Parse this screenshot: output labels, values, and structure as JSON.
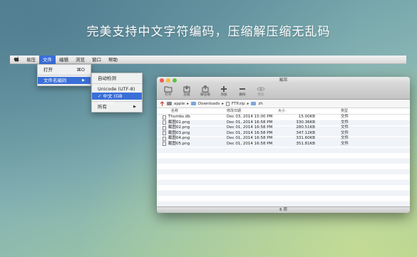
{
  "headline": "完美支持中文字符编码，压缩解压缩无乱码",
  "menubar": {
    "items": [
      "易压",
      "文件",
      "编辑",
      "浏览",
      "窗口",
      "帮助"
    ],
    "active_index": 1
  },
  "file_menu": {
    "items": [
      {
        "label": "打开",
        "shortcut": "⌘O"
      },
      {
        "label": "文件名编码",
        "submenu": "▶"
      }
    ]
  },
  "encoding_menu": {
    "items": [
      {
        "label": "自动检测"
      },
      {
        "label": "Unicode (UTF-8)"
      },
      {
        "label": "✓ 中文 (GB 18030)"
      },
      {
        "label": "所有",
        "submenu": "▶"
      }
    ],
    "selected_index": 2
  },
  "window": {
    "title": "易压",
    "toolbar": [
      "打开",
      "压缩",
      "解压缩",
      "添加",
      "删除",
      "预览"
    ],
    "path": [
      "apple",
      "Downloads",
      "FTP.zip",
      "zh"
    ],
    "columns": {
      "name": "名称",
      "date": "修改日期",
      "size": "大小",
      "kind": "类型"
    },
    "files": [
      {
        "name": "Thumbs.db",
        "date": "Dec 03, 2014 15:00 PM",
        "size": "15.00KB",
        "kind": "文件"
      },
      {
        "name": "截图01.png",
        "date": "Dec 01, 2014 16:58 PM",
        "size": "330.36KB",
        "kind": "文件"
      },
      {
        "name": "截图02.png",
        "date": "Dec 01, 2014 16:58 PM",
        "size": "280.51KB",
        "kind": "文件"
      },
      {
        "name": "截图03.png",
        "date": "Dec 01, 2014 16:58 PM",
        "size": "347.12KB",
        "kind": "文件"
      },
      {
        "name": "截图04.png",
        "date": "Dec 01, 2014 16:58 PM",
        "size": "331.60KB",
        "kind": "文件"
      },
      {
        "name": "截图05.png",
        "date": "Dec 01, 2014 16:58 PM",
        "size": "351.81KB",
        "kind": "文件"
      }
    ],
    "status": "6 项"
  },
  "colors": {
    "accent": "#3a6fd8",
    "close": "#ee5c54",
    "minimize": "#f6bc3a",
    "zoom": "#5ec142"
  }
}
